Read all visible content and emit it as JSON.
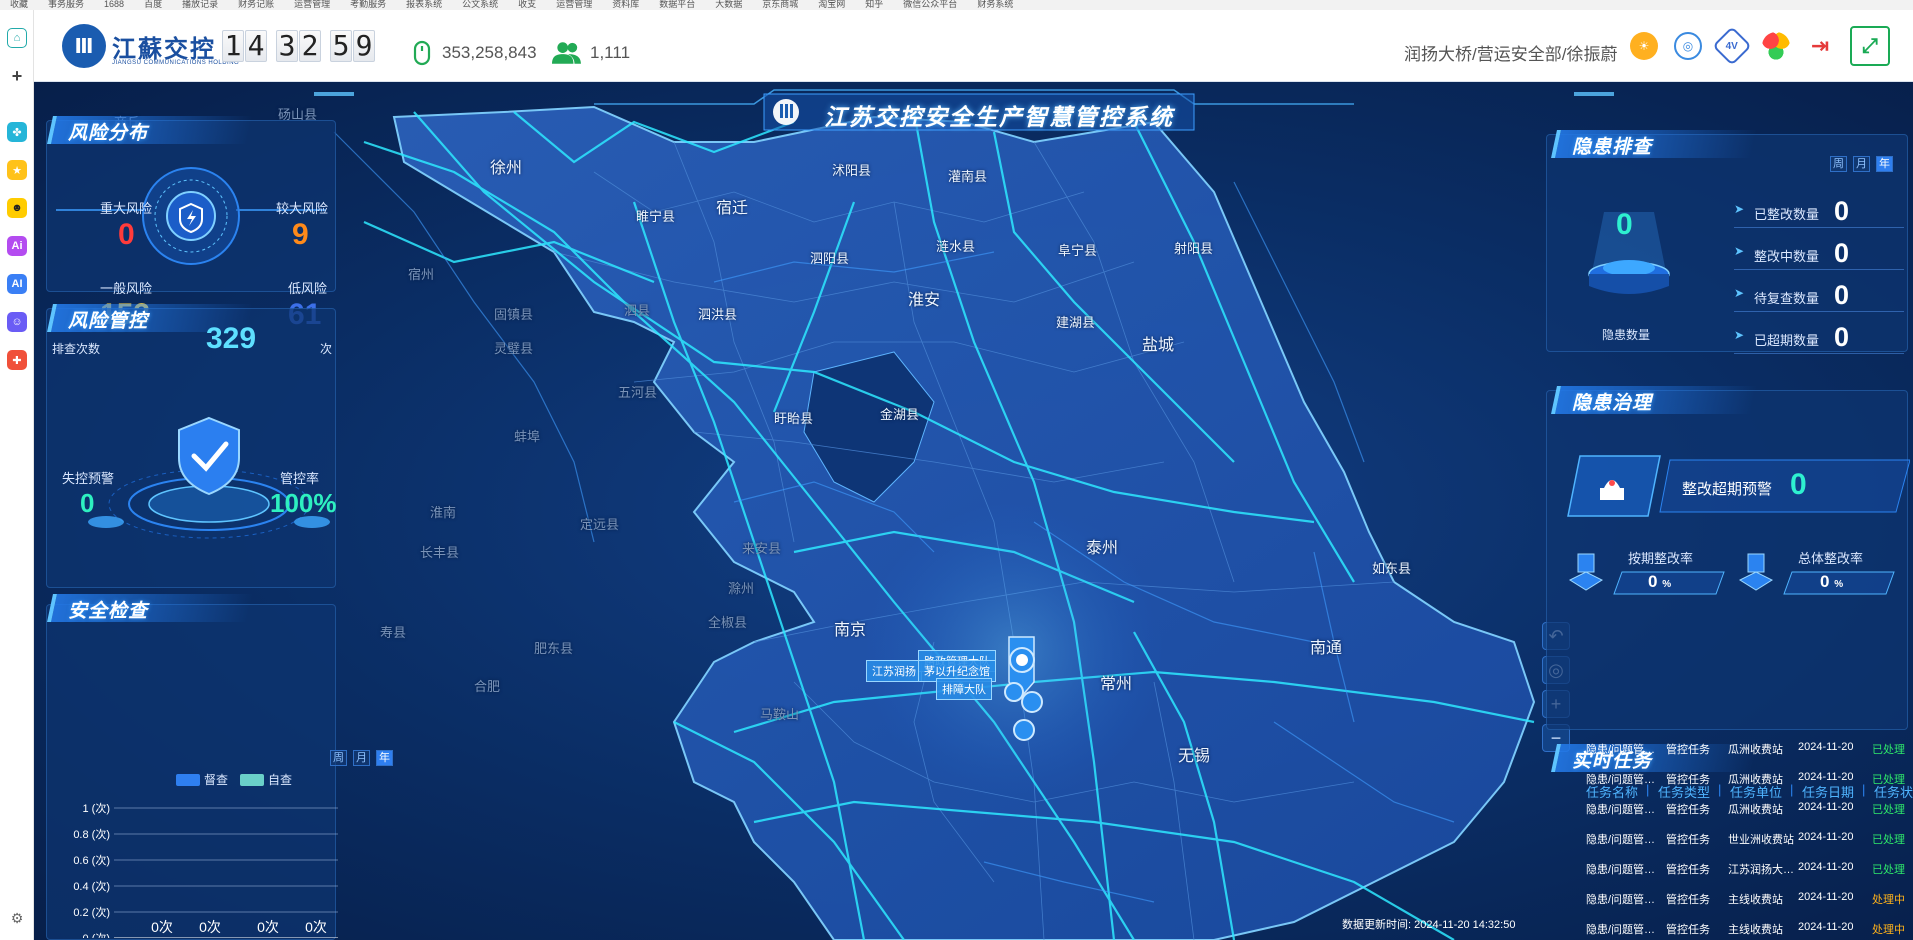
{
  "browser": {
    "bookmarks": [
      "收藏",
      "事务服务",
      "1688",
      "百度",
      "播放记录",
      "财务记账",
      "运营管理",
      "考勤服务",
      "报表系统",
      "公文系统",
      "收支",
      "运营管理",
      "资料库",
      "数据平台",
      "大数据",
      "京东商城",
      "淘宝网",
      "知乎",
      "微信公众平台",
      "财务系统"
    ]
  },
  "header": {
    "logo_text": "江蘇交控",
    "logo_sub": "JIANGSU COMMUNICATIONS HOLDING",
    "clock": [
      "1",
      "4",
      "3",
      "2",
      "5",
      "9"
    ],
    "visits": "353,258,843",
    "users": "1,111",
    "user_path": "润扬大桥/营运安全部/徐振蔚",
    "version_badge": "4V"
  },
  "dashboard": {
    "title": "江苏交控安全生产智慧管控系统",
    "risk_distribution": {
      "title": "风险分布",
      "major_label": "重大风险",
      "major_value": "0",
      "high_label": "较大风险",
      "high_value": "9",
      "general_label": "一般风险",
      "general_value": "153",
      "low_label": "低风险",
      "low_value": "61"
    },
    "risk_control": {
      "title": "风险管控",
      "check_label": "排查次数",
      "check_value": "329",
      "check_unit": "次",
      "loss_label": "失控预警",
      "loss_value": "0",
      "rate_label": "管控率",
      "rate_value": "100%"
    },
    "safety_check": {
      "title": "安全检查",
      "seg": [
        "周",
        "月",
        "年"
      ],
      "legend_a": "督查",
      "legend_b": "自查"
    },
    "hazard_check": {
      "title": "隐患排查",
      "seg": [
        "周",
        "月",
        "年"
      ],
      "total_value": "0",
      "total_label": "隐患数量",
      "rows": [
        {
          "label": "已整改数量",
          "value": "0"
        },
        {
          "label": "整改中数量",
          "value": "0"
        },
        {
          "label": "待复查数量",
          "value": "0"
        },
        {
          "label": "已超期数量",
          "value": "0"
        }
      ]
    },
    "hazard_govern": {
      "title": "隐患治理",
      "overdue_label": "整改超期预警",
      "overdue_value": "0",
      "ontime_label": "按期整改率",
      "ontime_value": "0",
      "overall_label": "总体整改率",
      "overall_value": "0",
      "pct": "%"
    },
    "tasks": {
      "title": "实时任务",
      "headers": [
        "任务名称",
        "任务类型",
        "任务单位",
        "任务日期",
        "任务状态"
      ],
      "rows": [
        {
          "name": "隐患/问题管…",
          "type": "管控任务",
          "unit": "瓜洲收费站",
          "date": "2024-11-20",
          "status": "已处理"
        },
        {
          "name": "隐患/问题管…",
          "type": "管控任务",
          "unit": "瓜洲收费站",
          "date": "2024-11-20",
          "status": "已处理"
        },
        {
          "name": "隐患/问题管…",
          "type": "管控任务",
          "unit": "瓜洲收费站",
          "date": "2024-11-20",
          "status": "已处理"
        },
        {
          "name": "隐患/问题管…",
          "type": "管控任务",
          "unit": "世业洲收费站",
          "date": "2024-11-20",
          "status": "已处理"
        },
        {
          "name": "隐患/问题管…",
          "type": "管控任务",
          "unit": "江苏润扬大…",
          "date": "2024-11-20",
          "status": "已处理"
        },
        {
          "name": "隐患/问题管…",
          "type": "管控任务",
          "unit": "主线收费站",
          "date": "2024-11-20",
          "status": "处理中"
        },
        {
          "name": "隐患/问题管…",
          "type": "管控任务",
          "unit": "主线收费站",
          "date": "2024-11-20",
          "status": "处理中"
        }
      ]
    },
    "update_time": "数据更新时间: 2024-11-20 14:32:50",
    "map_labels": {
      "xuzhou": "徐州",
      "suqian": "宿迁",
      "huaian": "淮安",
      "yancheng": "盐城",
      "taizhou": "泰州",
      "nanjing": "南京",
      "changzhou": "常州",
      "nantong": "南通",
      "wuxi": "无锡",
      "shuyang": "沭阳县",
      "guanyun": "灌南县",
      "lianshui": "涟水县",
      "funing": "阜宁县",
      "sheyang": "射阳县",
      "suining": "睢宁县",
      "siyang": "泗阳县",
      "sihong": "泗洪县",
      "jianhu": "建湖县",
      "xuyi": "盱眙县",
      "jinhu": "金湖县",
      "rudong": "如东县",
      "dim_1": "宿州",
      "dim_2": "泗县",
      "dim_3": "灵璧县",
      "dim_4": "固镇县",
      "dim_5": "五河县",
      "dim_6": "蚌埠",
      "dim_7": "淮南",
      "dim_8": "定远县",
      "dim_9": "滁州",
      "dim_10": "来安县",
      "dim_11": "全椒县",
      "dim_12": "合肥",
      "dim_13": "肥东县",
      "dim_14": "马鞍山",
      "dim_15": "砀山县",
      "dim_16": "商丘",
      "dim_17": "寿县",
      "dim_18": "长丰县",
      "marker_1": "江苏润扬",
      "marker_2": "茅以升纪念馆",
      "marker_3": "路政管理大队",
      "marker_4": "排障大队"
    }
  }
}
